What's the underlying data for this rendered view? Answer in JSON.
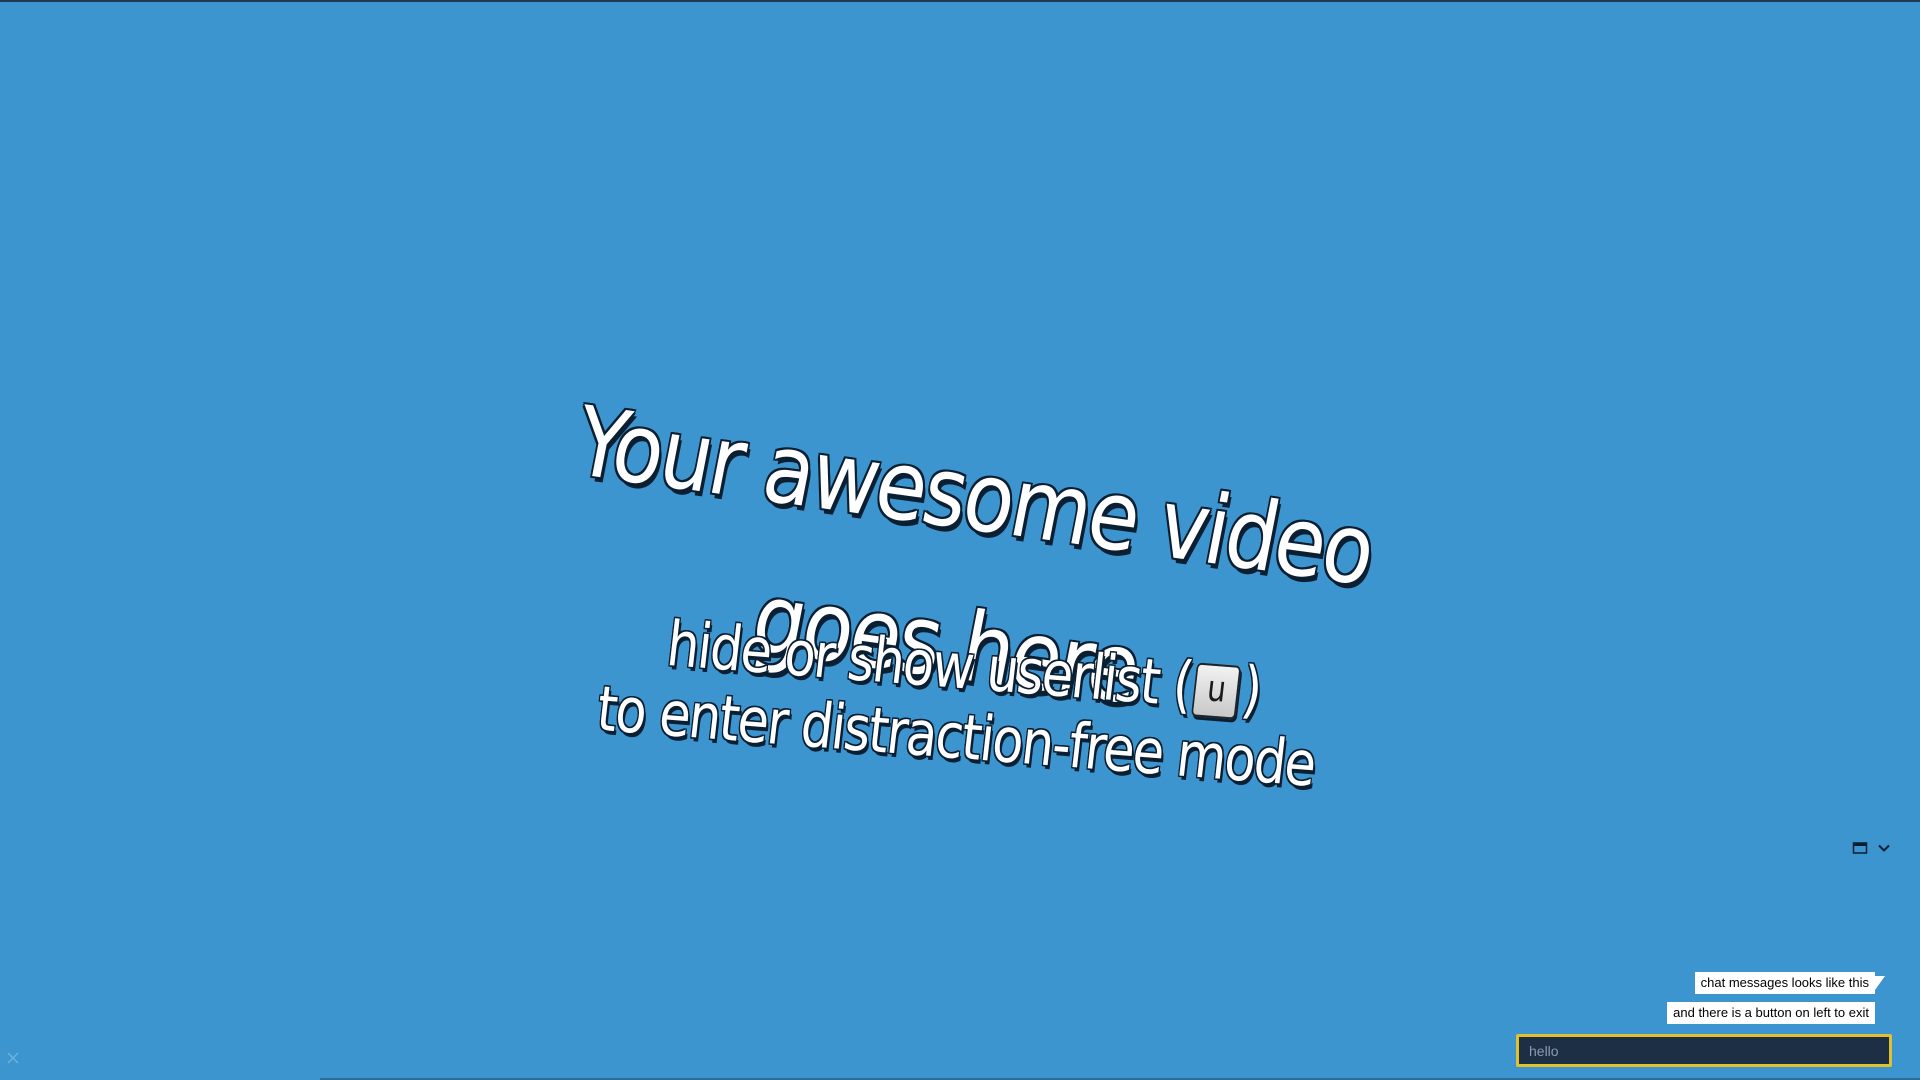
{
  "video": {
    "headline_line1": "Your awesome video",
    "headline_line2": "goes here",
    "hint_prefix": "hide or show userlist (",
    "hint_key": "u",
    "hint_suffix": ")",
    "hint_line2": "to enter distraction-free mode"
  },
  "controls": {
    "window_icon": "window-icon",
    "collapse_icon": "chevron-down-icon"
  },
  "chat": {
    "messages": [
      "chat messages looks like this",
      "and there is a button on left to exit"
    ],
    "input_placeholder": "hello"
  },
  "exit": {
    "icon": "close-icon"
  },
  "colors": {
    "background": "#3d95cf",
    "text_outline": "#0b1f33",
    "input_border": "#e0c030",
    "input_background": "#1d2f45"
  }
}
